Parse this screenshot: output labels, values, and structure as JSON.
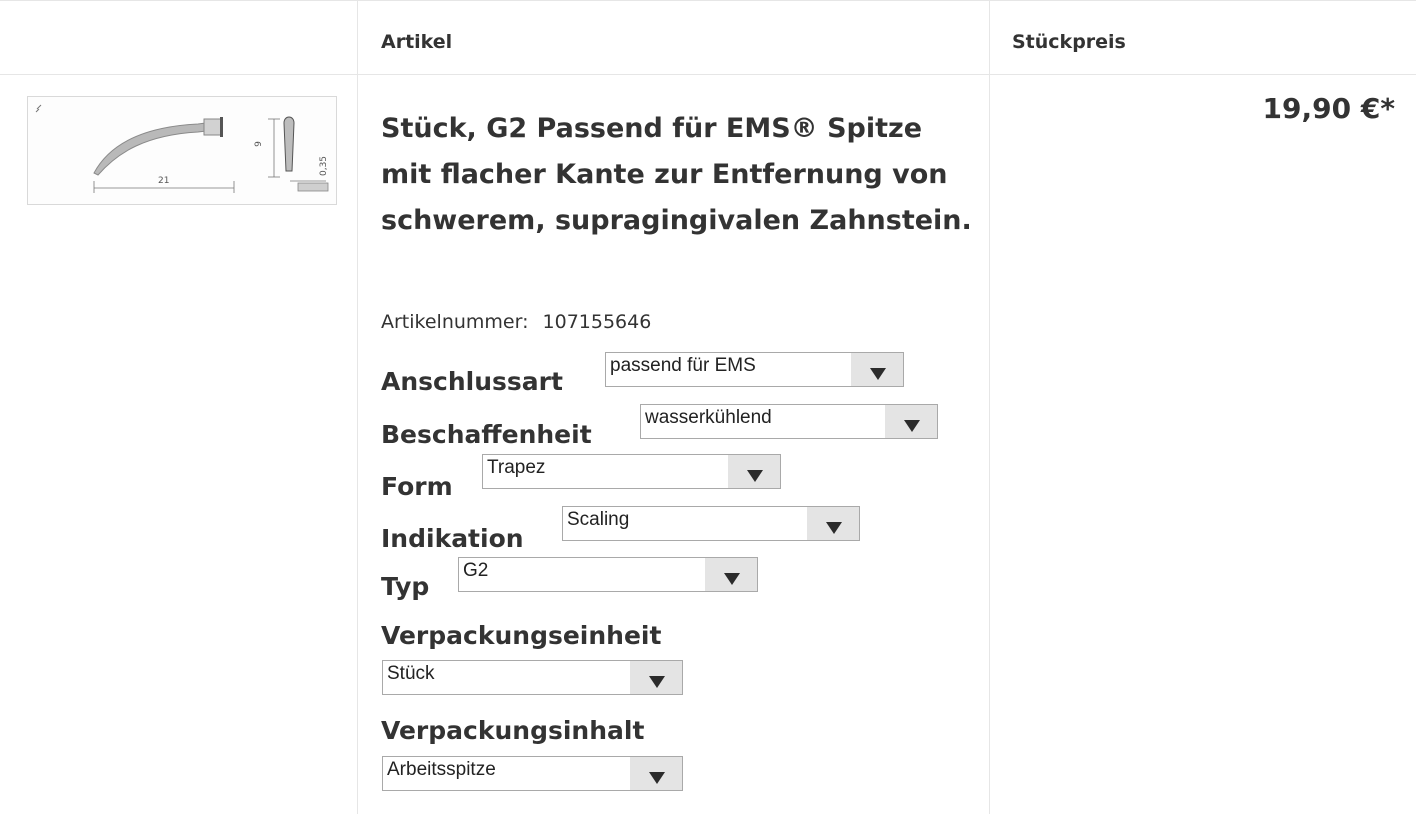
{
  "table": {
    "headers": {
      "image": "",
      "article": "Artikel",
      "unit_price": "Stückpreis"
    }
  },
  "product": {
    "title": "Stück, G2 Passend für EMS® Spitze mit flacher Kante zur Entfernung von schwerem, supragingivalen Zahnstein.",
    "article_number_label": "Artikelnummer:",
    "article_number": "107155646",
    "price": "19,90 €*",
    "image_labels": {
      "length": "21",
      "height": "9",
      "thickness": "0,35"
    },
    "options": [
      {
        "label": "Anschlussart",
        "value": "passend für EMS"
      },
      {
        "label": "Beschaffenheit",
        "value": "wasserkühlend"
      },
      {
        "label": "Form",
        "value": "Trapez"
      },
      {
        "label": "Indikation",
        "value": "Scaling"
      },
      {
        "label": "Typ",
        "value": "G2"
      },
      {
        "label": "Verpackungseinheit",
        "value": "Stück"
      },
      {
        "label": "Verpackungsinhalt",
        "value": "Arbeitsspitze"
      }
    ]
  },
  "icons": {
    "dropdown": "triangle-down-icon"
  },
  "colors": {
    "text": "#333333",
    "border": "#e6e6e6",
    "select_button": "#e4e4e4"
  }
}
